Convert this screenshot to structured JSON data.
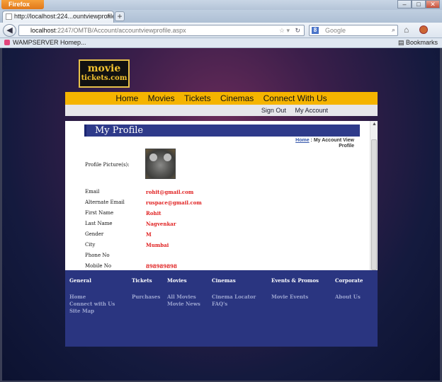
{
  "browser": {
    "app_button": "Firefox",
    "tab_title": "http://localhost:224...ountviewprofile.aspx",
    "url_host": "localhost",
    "url_rest": ":2247/OMTB/Account/accountviewprofile.aspx",
    "search_placeholder": "Google",
    "bookmark_item": "WAMPSERVER Homep...",
    "bookmarks_label": "Bookmarks"
  },
  "site": {
    "logo_line1": "movie",
    "logo_line2": "tickets.com",
    "menu": [
      "Home",
      "Movies",
      "Tickets",
      "Cinemas",
      "Connect With Us"
    ],
    "subnav": [
      "Sign Out",
      "My Account"
    ]
  },
  "profile": {
    "title": "My Profile",
    "breadcrumb_home": "Home",
    "breadcrumb_current": " : My Account View Profile",
    "picture_label": "Profile Picture(s):",
    "fields": [
      {
        "label": "Email",
        "value": "rohit@gmail.com"
      },
      {
        "label": "Alternate Email",
        "value": "ruspace@gmail.com"
      },
      {
        "label": "First Name",
        "value": "Rohit"
      },
      {
        "label": "Last Name",
        "value": "Nagvenkar"
      },
      {
        "label": "Gender",
        "value": "M"
      },
      {
        "label": "City",
        "value": "Mumbai"
      },
      {
        "label": "Phone No",
        "value": ""
      },
      {
        "label": "Mobile No",
        "value": "898989898"
      }
    ]
  },
  "footer": {
    "columns": [
      {
        "heading": "General",
        "links": [
          "Home",
          "Connect with Us",
          "Site Map"
        ]
      },
      {
        "heading": "Tickets",
        "links": [
          "Purchases"
        ]
      },
      {
        "heading": "Movies",
        "links": [
          "All Movies",
          "Movie News"
        ]
      },
      {
        "heading": "Cinemas",
        "links": [
          "Cinema Locator",
          "FAQ's"
        ]
      },
      {
        "heading": "Events & Promos",
        "links": [
          "Movie Events"
        ]
      },
      {
        "heading": "Corporate",
        "links": [
          "About Us"
        ]
      }
    ]
  }
}
